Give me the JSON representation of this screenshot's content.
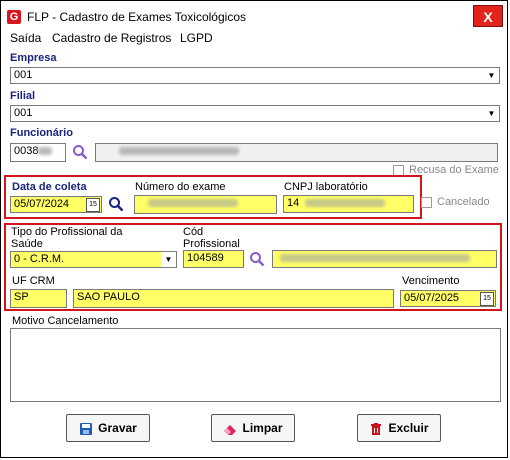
{
  "window": {
    "title": "FLP - Cadastro de Exames Toxicológicos",
    "icon_letter": "G",
    "close_label": "X"
  },
  "menu": [
    {
      "label": "Saída"
    },
    {
      "label": "Cadastro de Registros"
    },
    {
      "label": "LGPD"
    }
  ],
  "empresa": {
    "label": "Empresa",
    "value": "001"
  },
  "filial": {
    "label": "Filial",
    "value": "001"
  },
  "funcionario": {
    "label": "Funcionário",
    "code": "0038"
  },
  "recusa": {
    "label": "Recusa do Exame",
    "checked": false
  },
  "coleta": {
    "label": "Data de coleta",
    "value": "05/07/2024",
    "cal_icon": "15"
  },
  "numero_exame": {
    "label": "Número do exame"
  },
  "cnpj": {
    "label": "CNPJ laboratório",
    "prefix": "14"
  },
  "cancelado": {
    "label": "Cancelado",
    "checked": false
  },
  "tipo_prof": {
    "label_line1": "Tipo do Profissional da",
    "label_line2": "Saúde",
    "value": "0  - C.R.M."
  },
  "cod_prof": {
    "label_line1": "Cód",
    "label_line2": "Profissional",
    "value": "104589"
  },
  "uf_crm": {
    "label": "UF CRM",
    "value": "SP",
    "state_name": "SAO PAULO"
  },
  "vencimento": {
    "label": "Vencimento",
    "value": "05/07/2025",
    "cal_icon": "15"
  },
  "motivo": {
    "label": "Motivo Cancelamento",
    "value": ""
  },
  "buttons": {
    "gravar": "Gravar",
    "limpar": "Limpar",
    "excluir": "Excluir"
  },
  "colors": {
    "highlight_yellow": "#ffff66",
    "annotation_red": "#d4141c",
    "label_blue": "#1a237e"
  }
}
